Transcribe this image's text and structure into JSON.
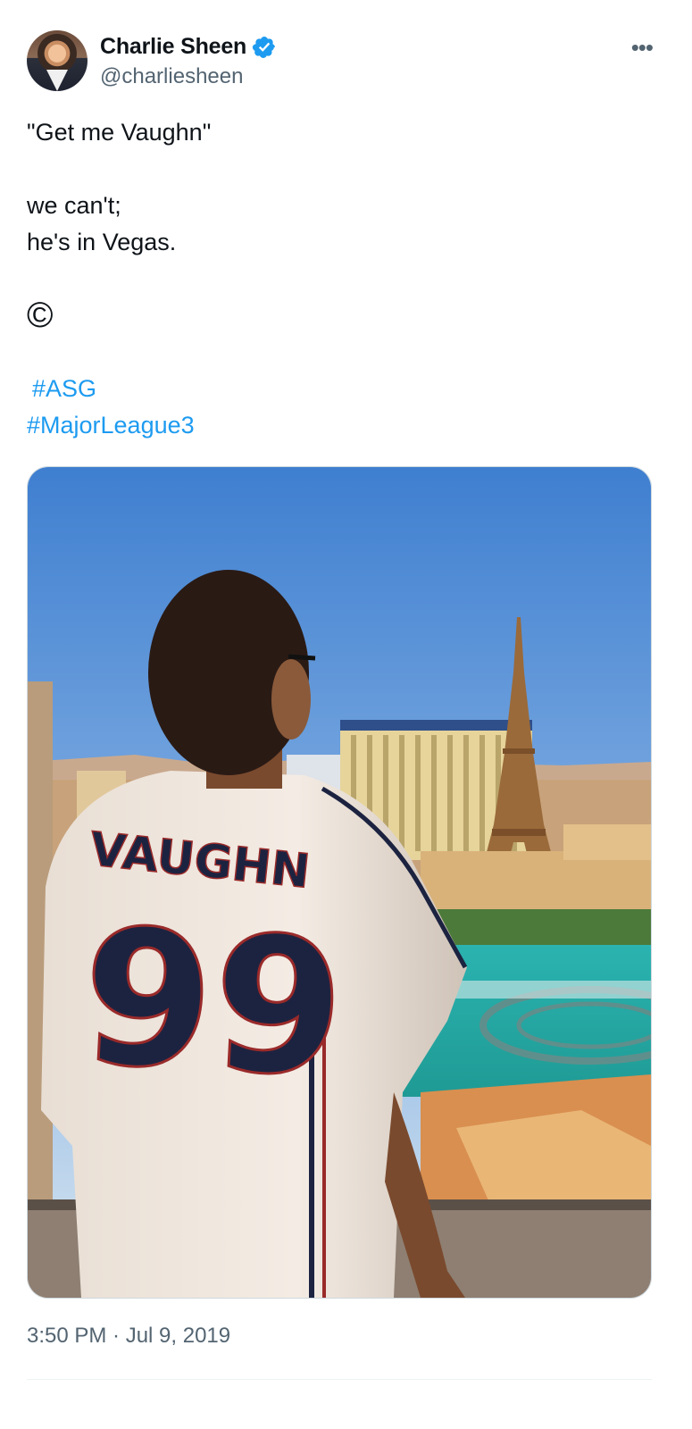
{
  "author": {
    "display_name": "Charlie Sheen",
    "handle": "@charliesheen",
    "verified": true
  },
  "tweet": {
    "lines": [
      "\"Get me Vaughn\"",
      "we can't;",
      "he's in Vegas."
    ],
    "symbol": "©",
    "hashtags": [
      "#ASG",
      "#MajorLeague3"
    ]
  },
  "media": {
    "jersey_name": "VAUGHN",
    "jersey_number": "99"
  },
  "timestamp": "3:50 PM · Jul 9, 2019",
  "icons": {
    "verified": "verified-badge-icon",
    "more": "more-options-icon"
  },
  "colors": {
    "link": "#1d9bf0",
    "secondary_text": "#536471",
    "verified": "#1d9bf0"
  }
}
